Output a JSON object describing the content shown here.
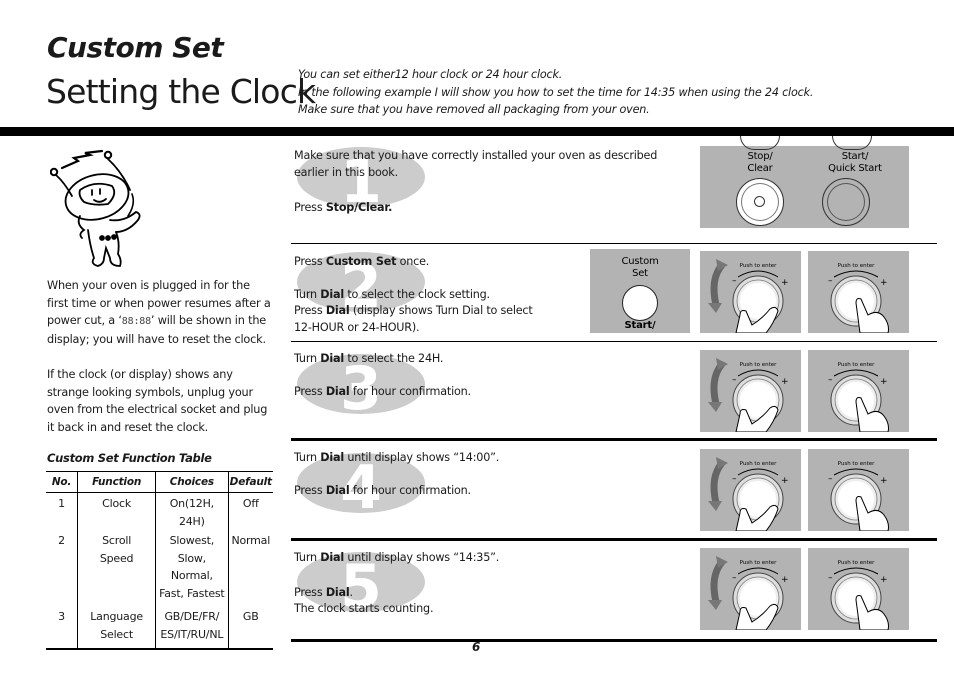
{
  "header": {
    "section": "Custom Set",
    "title": "Setting the Clock",
    "intro": [
      "You can set either12 hour clock or 24 hour clock.",
      "In the following example I will show you how to set the time for 14:35 when using the 24 clock.",
      "Make sure that you have removed all packaging from your oven."
    ]
  },
  "left": {
    "para1_pre": "When your oven is plugged in for the first time or when power resumes after a power cut, a ‘",
    "para1_lcd": "88:88",
    "para1_post": "’ will be shown in the display; you will have to reset the clock.",
    "para2": "If the clock (or display) shows any strange looking symbols, unplug your oven from the electrical socket and plug it back in and reset the clock."
  },
  "table": {
    "title": "Custom Set Function Table",
    "headers": [
      "No.",
      "Function",
      "Choices",
      "Default"
    ],
    "rows": [
      {
        "no": "1",
        "function": "Clock",
        "choices": "On(12H, 24H)",
        "default": "Off"
      },
      {
        "no": "2",
        "function_l1": "Scroll",
        "function_l2": "Speed",
        "choices_l1": "Slowest, Slow,",
        "choices_l2": "Normal,",
        "choices_l3": "Fast, Fastest",
        "default": "Normal"
      },
      {
        "no": "3",
        "function_l1": "Language",
        "function_l2": "Select",
        "choices_l1": "GB/DE/FR/",
        "choices_l2": "ES/IT/RU/NL",
        "default": "GB"
      }
    ]
  },
  "steps": [
    {
      "number": "1",
      "line1": "Make sure that you have correctly installed your oven as described",
      "line2": "earlier in this book.",
      "press": "Press ",
      "press_bold": "Stop/Clear.",
      "panel": {
        "stop_label_1": "Stop/",
        "stop_label_2": "Clear",
        "start_label_1": "Start/",
        "start_label_2": "Quick Start"
      }
    },
    {
      "number": "2",
      "l1_pre": "Press ",
      "l1_bold": "Custom Set",
      "l1_post": " once.",
      "l2_pre": "Turn ",
      "l2_bold": "Dial",
      "l2_post": " to select the clock setting.",
      "l3_pre": "Press ",
      "l3_bold": "Dial",
      "l3_post": " (display shows Turn Dial to select",
      "l4": "12-HOUR or 24-HOUR).",
      "panel": {
        "label_1": "Custom",
        "label_2": "Set",
        "label_3": "Start/"
      }
    },
    {
      "number": "3",
      "l1_pre": "Turn ",
      "l1_bold": "Dial",
      "l1_post": " to select the 24H.",
      "l2_pre": "Press ",
      "l2_bold": "Dial",
      "l2_post": " for hour confirmation."
    },
    {
      "number": "4",
      "l1_pre": "Turn ",
      "l1_bold": "Dial",
      "l1_post": " until display shows “14:00”.",
      "l2_pre": "Press ",
      "l2_bold": "Dial",
      "l2_post": " for hour confirmation."
    },
    {
      "number": "5",
      "l1_pre": "Turn ",
      "l1_bold": "Dial",
      "l1_post": " until display shows “14:35”.",
      "l2_pre": "Press ",
      "l2_bold": "Dial",
      "l2_post": ".",
      "l3": "The clock starts counting."
    }
  ],
  "dial": {
    "push_label": "Push to enter",
    "minus": "–",
    "plus": "+"
  },
  "footer": {
    "page": "6"
  },
  "colors": {
    "panel_gray": "#b3b3b3",
    "number_gray": "#cccccc",
    "rule": "#000000"
  }
}
